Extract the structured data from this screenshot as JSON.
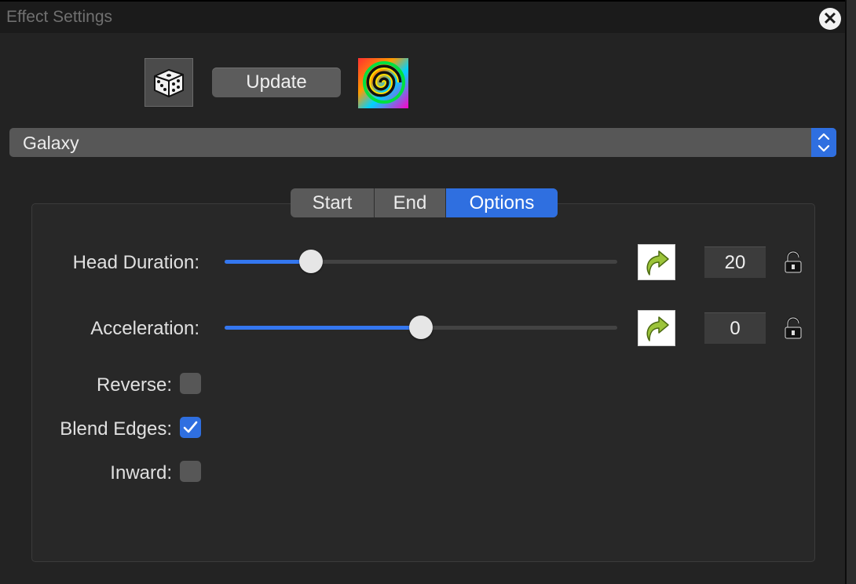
{
  "window": {
    "title": "Effect Settings",
    "close_icon": "close-icon"
  },
  "toolbar": {
    "dice_icon": "dice-icon",
    "update_label": "Update",
    "effect_icon": "spiral-color-icon"
  },
  "effect_select": {
    "value": "Galaxy",
    "icon": "chevron-up-down-icon"
  },
  "tabs": [
    {
      "label": "Start",
      "selected": false
    },
    {
      "label": "End",
      "selected": false
    },
    {
      "label": "Options",
      "selected": true
    }
  ],
  "options": {
    "head_duration": {
      "label": "Head Duration:",
      "value": "20",
      "slider_fraction": 0.22,
      "reset_icon": "curved-arrow-reset-icon",
      "lock_icon": "unlocked-padlock-icon"
    },
    "acceleration": {
      "label": "Acceleration:",
      "value": "0",
      "slider_fraction": 0.5,
      "reset_icon": "curved-arrow-reset-icon",
      "lock_icon": "unlocked-padlock-icon"
    },
    "reverse": {
      "label": "Reverse:",
      "checked": false
    },
    "blend_edges": {
      "label": "Blend Edges:",
      "checked": true
    },
    "inward": {
      "label": "Inward:",
      "checked": false
    }
  },
  "colors": {
    "accent": "#2f6fe0",
    "slider_fill": "#3477f0",
    "background": "#232323"
  }
}
